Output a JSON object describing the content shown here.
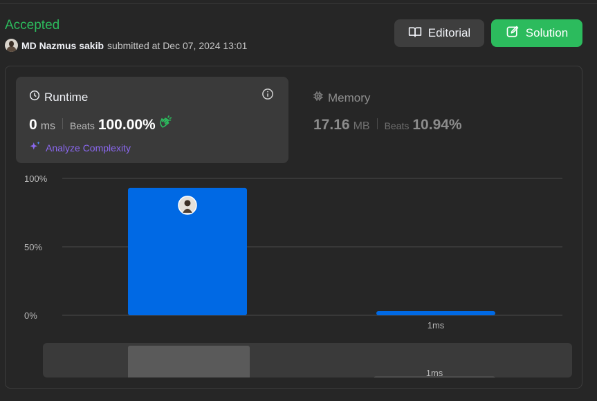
{
  "header": {
    "status": "Accepted",
    "username": "MD Nazmus sakib",
    "submitted_text": "submitted at Dec 07, 2024 13:01"
  },
  "buttons": {
    "editorial": "Editorial",
    "solution": "Solution"
  },
  "runtime": {
    "title": "Runtime",
    "value": "0",
    "unit": "ms",
    "beats_label": "Beats",
    "beats_value": "100.00%",
    "analyze_label": "Analyze Complexity"
  },
  "memory": {
    "title": "Memory",
    "value": "17.16",
    "unit": "MB",
    "beats_label": "Beats",
    "beats_value": "10.94%"
  },
  "colors": {
    "accepted": "#2cbb5d",
    "bar": "#0069e4",
    "analyze": "#8b68f0",
    "strip_bar": "#5a5a5a"
  },
  "chart_data": {
    "type": "bar",
    "ylabel_ticks": [
      "100%",
      "50%",
      "0%"
    ],
    "ylim": [
      0,
      100
    ],
    "categories": [
      "",
      "1ms"
    ],
    "values": [
      93,
      3
    ],
    "grid": true,
    "mini_overview": {
      "categories": [
        "",
        "1ms"
      ],
      "values": [
        93,
        3
      ]
    }
  }
}
